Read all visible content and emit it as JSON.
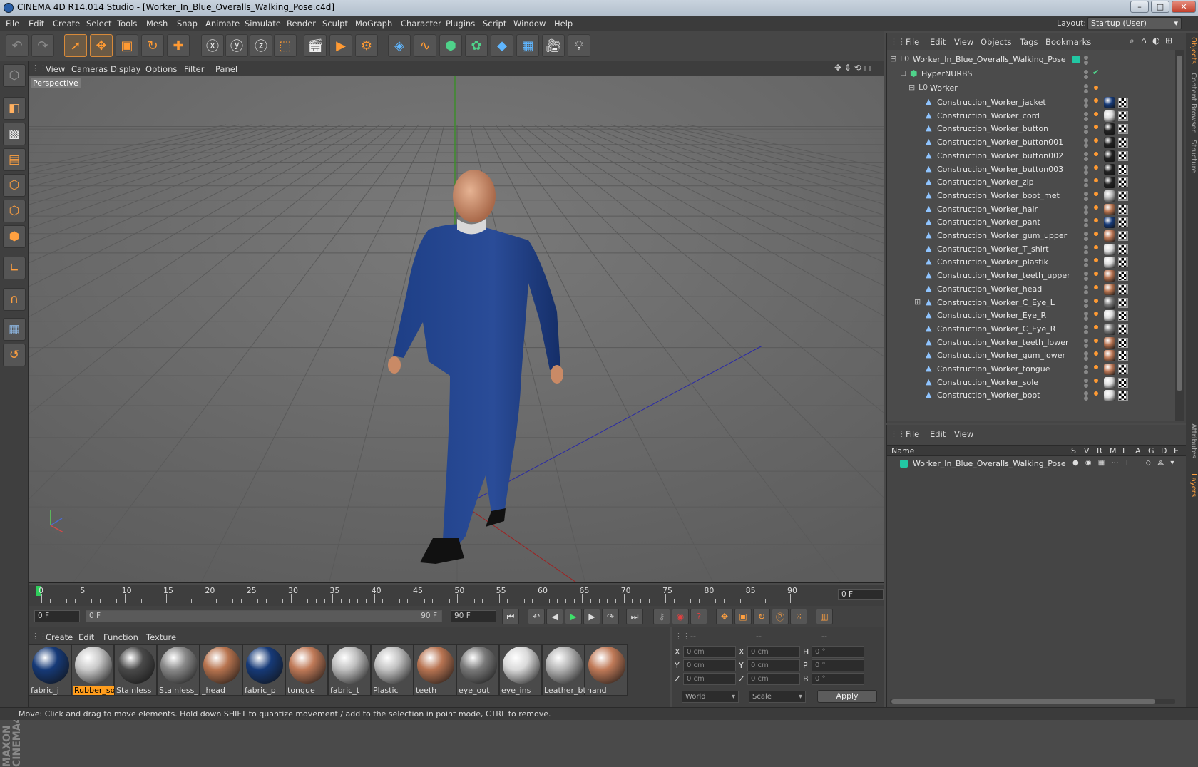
{
  "window": {
    "title": "CINEMA 4D R14.014 Studio - [Worker_In_Blue_Overalls_Walking_Pose.c4d]",
    "btn_min": "–",
    "btn_max": "□",
    "btn_close": "✕"
  },
  "menubar": {
    "items": [
      "File",
      "Edit",
      "Create",
      "Select",
      "Tools",
      "Mesh",
      "Snap",
      "Animate",
      "Simulate",
      "Render",
      "Sculpt",
      "MoGraph",
      "Character",
      "Plugins",
      "Script",
      "Window",
      "Help"
    ],
    "layout_label": "Layout:",
    "layout_value": "Startup (User)"
  },
  "viewport": {
    "menu": [
      "View",
      "Cameras",
      "Display",
      "Options",
      "Filter",
      "Panel"
    ],
    "label": "Perspective"
  },
  "timeline": {
    "ticks": [
      "0",
      "5",
      "10",
      "15",
      "20",
      "25",
      "30",
      "35",
      "40",
      "45",
      "50",
      "55",
      "60",
      "65",
      "70",
      "75",
      "80",
      "85",
      "90"
    ],
    "current_frame": "0 F"
  },
  "transport": {
    "start_field": "0 F",
    "range_start": "0 F",
    "range_end": "90 F",
    "end_field": "90 F"
  },
  "materials": {
    "menu": [
      "Create",
      "Edit",
      "Function",
      "Texture"
    ],
    "items": [
      {
        "label": "fabric_j",
        "color": "#163a78",
        "selected": false
      },
      {
        "label": "Rubber_so",
        "color": "#c9c9c9",
        "selected": true
      },
      {
        "label": "Stainless",
        "color": "#4a4a4a",
        "selected": false
      },
      {
        "label": "Stainless_",
        "color": "#8a8a8a",
        "selected": false
      },
      {
        "label": "_head",
        "color": "#b8744f",
        "selected": false
      },
      {
        "label": "fabric_p",
        "color": "#163a78",
        "selected": false
      },
      {
        "label": "tongue",
        "color": "#c07a58",
        "selected": false
      },
      {
        "label": "fabric_t",
        "color": "#bfbfbf",
        "selected": false
      },
      {
        "label": "Plastic",
        "color": "#c2c2c2",
        "selected": false
      },
      {
        "label": "teeth",
        "color": "#b87452",
        "selected": false
      },
      {
        "label": "eye_out",
        "color": "#7a7a7a",
        "selected": false
      },
      {
        "label": "eye_ins",
        "color": "#d9d9d9",
        "selected": false
      },
      {
        "label": "Leather_bt",
        "color": "#b5b5b5",
        "selected": false
      },
      {
        "label": "hand",
        "color": "#c07a58",
        "selected": false
      }
    ]
  },
  "coords": {
    "header": [
      "--",
      "--",
      "--"
    ],
    "rows": [
      {
        "a": "X",
        "av": "0 cm",
        "b": "X",
        "bv": "0 cm",
        "c": "H",
        "cv": "0 °"
      },
      {
        "a": "Y",
        "av": "0 cm",
        "b": "Y",
        "bv": "0 cm",
        "c": "P",
        "cv": "0 °"
      },
      {
        "a": "Z",
        "av": "0 cm",
        "b": "Z",
        "bv": "0 cm",
        "c": "B",
        "cv": "0 °"
      }
    ],
    "mode1": "World",
    "mode2": "Scale",
    "apply": "Apply"
  },
  "objects": {
    "menu": [
      "File",
      "Edit",
      "View",
      "Objects",
      "Tags",
      "Bookmarks"
    ],
    "root": "Worker_In_Blue_Overalls_Walking_Pose",
    "hypernurbs": "HyperNURBS",
    "group": "Worker",
    "children": [
      {
        "name": "Construction_Worker_jacket",
        "mat": "#163a78"
      },
      {
        "name": "Construction_Worker_cord",
        "mat": "#dcdcdc"
      },
      {
        "name": "Construction_Worker_button",
        "mat": "#222222"
      },
      {
        "name": "Construction_Worker_button001",
        "mat": "#222222"
      },
      {
        "name": "Construction_Worker_button002",
        "mat": "#222222"
      },
      {
        "name": "Construction_Worker_button003",
        "mat": "#222222"
      },
      {
        "name": "Construction_Worker_zip",
        "mat": "#222222"
      },
      {
        "name": "Construction_Worker_boot_met",
        "mat": "#bbbbbb"
      },
      {
        "name": "Construction_Worker_hair",
        "mat": "#b8744f"
      },
      {
        "name": "Construction_Worker_pant",
        "mat": "#163a78"
      },
      {
        "name": "Construction_Worker_gum_upper",
        "mat": "#c07a58"
      },
      {
        "name": "Construction_Worker_T_shirt",
        "mat": "#dcdcdc"
      },
      {
        "name": "Construction_Worker_plastik",
        "mat": "#dcdcdc"
      },
      {
        "name": "Construction_Worker_teeth_upper",
        "mat": "#b87452"
      },
      {
        "name": "Construction_Worker_head",
        "mat": "#b8744f"
      },
      {
        "name": "Construction_Worker_C_Eye_L",
        "mat": "#777777"
      },
      {
        "name": "Construction_Worker_Eye_R",
        "mat": "#dddddd"
      },
      {
        "name": "Construction_Worker_C_Eye_R",
        "mat": "#777777"
      },
      {
        "name": "Construction_Worker_teeth_lower",
        "mat": "#b87452"
      },
      {
        "name": "Construction_Worker_gum_lower",
        "mat": "#c07a58"
      },
      {
        "name": "Construction_Worker_tongue",
        "mat": "#c07a58"
      },
      {
        "name": "Construction_Worker_sole",
        "mat": "#dcdcdc"
      },
      {
        "name": "Construction_Worker_boot",
        "mat": "#dcdcdc"
      }
    ]
  },
  "layers": {
    "menu": [
      "File",
      "Edit",
      "View"
    ],
    "columns": [
      "Name",
      "S",
      "V",
      "R",
      "M",
      "L",
      "A",
      "G",
      "D",
      "E"
    ],
    "row": "Worker_In_Blue_Overalls_Walking_Pose"
  },
  "sidetabs": [
    "Objects",
    "Content Browser",
    "Structure",
    "Attributes",
    "Layers"
  ],
  "status": "Move: Click and drag to move elements. Hold down SHIFT to quantize movement / add to the selection in point mode, CTRL to remove."
}
